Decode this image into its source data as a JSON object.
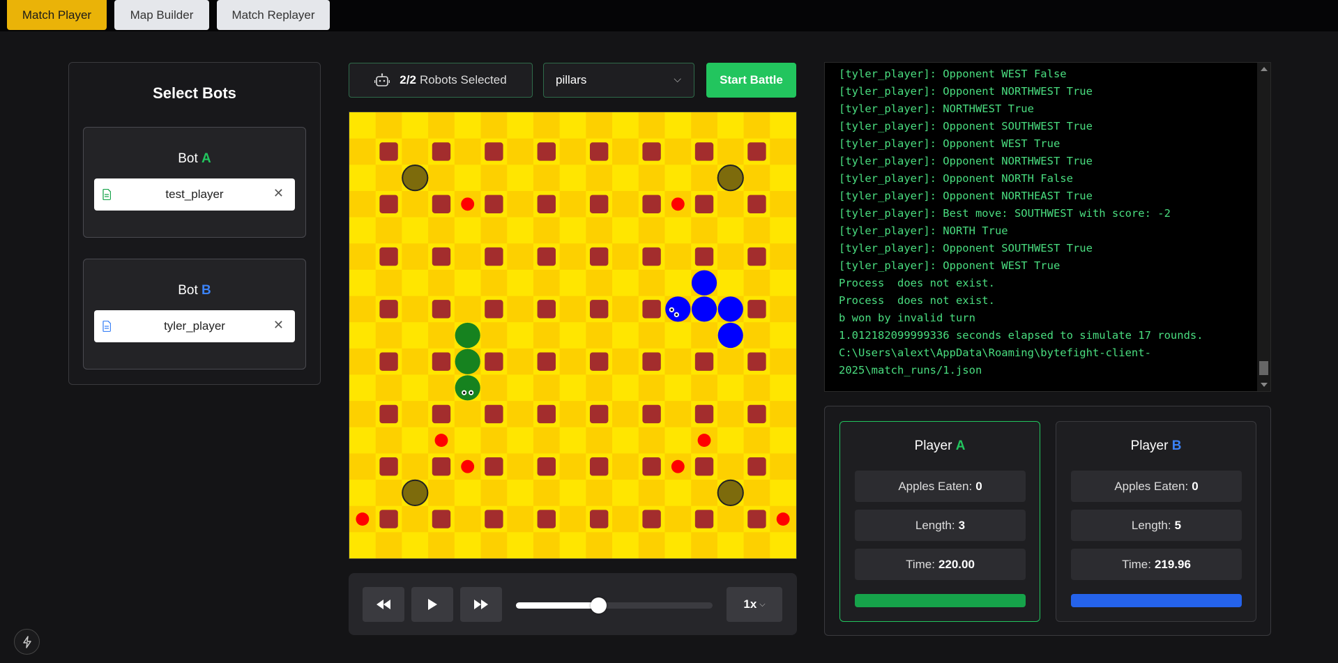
{
  "nav": {
    "tabs": [
      {
        "label": "Match Player",
        "active": true
      },
      {
        "label": "Map Builder",
        "active": false
      },
      {
        "label": "Match Replayer",
        "active": false
      }
    ]
  },
  "bots": {
    "title": "Select Bots",
    "a": {
      "prefix": "Bot ",
      "letter": "A",
      "file": "test_player",
      "icon_color": "#16a34a"
    },
    "b": {
      "prefix": "Bot ",
      "letter": "B",
      "file": "tyler_player",
      "icon_color": "#3b82f6"
    }
  },
  "controls": {
    "robots_count": "2/2",
    "robots_label": "Robots Selected",
    "map_selected": "pillars",
    "start_label": "Start Battle"
  },
  "board": {
    "rows": 17,
    "cols": 17,
    "colors": {
      "tile_light": "#ffe600",
      "tile_dark": "#fdd000",
      "wall": "#a32d2d",
      "apple": "#ff0000",
      "portal": "#7d6b0c",
      "snake_a": "#16821f",
      "snake_b": "#0000ff"
    },
    "wall_rows": [
      1,
      3,
      5,
      7,
      9,
      11,
      13,
      15
    ],
    "wall_cols": [
      1,
      3,
      5,
      7,
      9,
      11,
      13,
      15
    ],
    "missing_walls": [
      [
        7,
        13
      ]
    ],
    "apples": [
      [
        3,
        4
      ],
      [
        3,
        12
      ],
      [
        12,
        3
      ],
      [
        12,
        13
      ],
      [
        13,
        4
      ],
      [
        13,
        12
      ],
      [
        15,
        0
      ],
      [
        15,
        16
      ]
    ],
    "portals": [
      [
        2,
        2
      ],
      [
        2,
        14
      ],
      [
        14,
        2
      ],
      [
        14,
        14
      ]
    ],
    "snake_a": {
      "head": [
        10,
        4
      ],
      "body": [
        [
          9,
          4
        ],
        [
          8,
          4
        ]
      ]
    },
    "snake_b": {
      "head": [
        7,
        12
      ],
      "body": [
        [
          6,
          13
        ],
        [
          7,
          14
        ],
        [
          8,
          14
        ],
        [
          7,
          13
        ]
      ]
    }
  },
  "playback": {
    "speed": "1x",
    "progress": 0.42
  },
  "console": {
    "lines": [
      "[tyler_player]: Opponent WEST False",
      "[tyler_player]: Opponent NORTHWEST True",
      "[tyler_player]: NORTHWEST True",
      "[tyler_player]: Opponent SOUTHWEST True",
      "[tyler_player]: Opponent WEST True",
      "[tyler_player]: Opponent NORTHWEST True",
      "[tyler_player]: Opponent NORTH False",
      "[tyler_player]: Opponent NORTHEAST True",
      "[tyler_player]: Best move: SOUTHWEST with score: -2",
      "[tyler_player]: NORTH True",
      "[tyler_player]: Opponent SOUTHWEST True",
      "[tyler_player]: Opponent WEST True",
      "Process  does not exist.",
      "Process  does not exist.",
      "b won by invalid turn",
      "1.012182099999336 seconds elapsed to simulate 17 rounds.",
      "C:\\Users\\alext\\AppData\\Roaming\\bytefight-client-2025\\match_runs/1.json"
    ]
  },
  "players": {
    "a": {
      "prefix": "Player ",
      "letter": "A",
      "apples_label": "Apples Eaten:",
      "apples": "0",
      "length_label": "Length:",
      "length": "3",
      "time_label": "Time:",
      "time": "220.00",
      "bar_color": "#16a34a"
    },
    "b": {
      "prefix": "Player ",
      "letter": "B",
      "apples_label": "Apples Eaten:",
      "apples": "0",
      "length_label": "Length:",
      "length": "5",
      "time_label": "Time:",
      "time": "219.96",
      "bar_color": "#2563eb"
    }
  }
}
